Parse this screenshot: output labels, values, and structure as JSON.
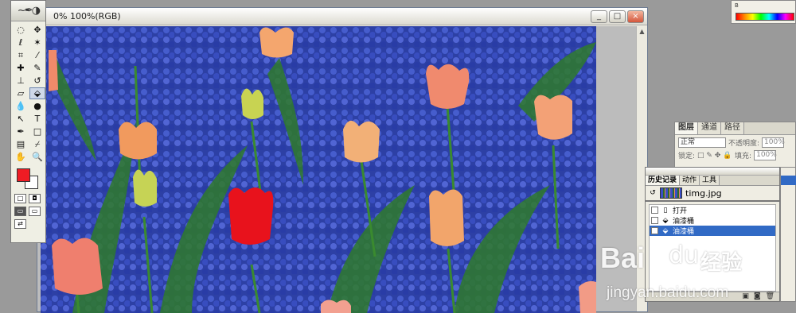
{
  "document": {
    "title": "0% 100%(RGB)",
    "buttons": [
      "_",
      "□",
      "×"
    ]
  },
  "toolbox": {
    "logo_icon": "feather-icon",
    "tools": [
      {
        "name": "marquee-icon",
        "glyph": "◌"
      },
      {
        "name": "move-icon",
        "glyph": "✥"
      },
      {
        "name": "lasso-icon",
        "glyph": "ℓ"
      },
      {
        "name": "magic-wand-icon",
        "glyph": "✶"
      },
      {
        "name": "crop-icon",
        "glyph": "⌗"
      },
      {
        "name": "slice-icon",
        "glyph": "⁄"
      },
      {
        "name": "healing-brush-icon",
        "glyph": "✚"
      },
      {
        "name": "brush-icon",
        "glyph": "✎"
      },
      {
        "name": "clone-stamp-icon",
        "glyph": "⊥"
      },
      {
        "name": "history-brush-icon",
        "glyph": "↺"
      },
      {
        "name": "eraser-icon",
        "glyph": "▱"
      },
      {
        "name": "paint-bucket-icon",
        "glyph": "⬙"
      },
      {
        "name": "blur-icon",
        "glyph": "💧"
      },
      {
        "name": "dodge-icon",
        "glyph": "●"
      },
      {
        "name": "path-select-icon",
        "glyph": "↖"
      },
      {
        "name": "type-icon",
        "glyph": "T"
      },
      {
        "name": "pen-icon",
        "glyph": "✒"
      },
      {
        "name": "rectangle-icon",
        "glyph": "□"
      },
      {
        "name": "notes-icon",
        "glyph": "▤"
      },
      {
        "name": "eyedropper-icon",
        "glyph": "⌿"
      },
      {
        "name": "hand-icon",
        "glyph": "✋"
      },
      {
        "name": "zoom-icon",
        "glyph": "🔍"
      }
    ],
    "active_tool": "paint-bucket-icon",
    "foreground_color": "#ee1c24",
    "background_color": "#ffffff"
  },
  "layers_panel": {
    "tabs": [
      "图层",
      "通道",
      "路径"
    ],
    "blend_mode": "正常",
    "opacity_label": "不透明度:",
    "opacity_value": "100%",
    "lock_label": "锁定:",
    "fill_label": "填充:",
    "fill_value": "100%"
  },
  "history_panel": {
    "tabs": [
      "历史记录",
      "动作",
      "工具"
    ],
    "snapshot_name": "timg.jpg",
    "items": [
      {
        "label": "打开",
        "icon": "document-icon",
        "glyph": "▯"
      },
      {
        "label": "油漆桶",
        "icon": "paint-bucket-icon",
        "glyph": "⬙"
      },
      {
        "label": "油漆桶",
        "icon": "paint-bucket-icon",
        "glyph": "⬙"
      }
    ],
    "active_index": 2,
    "footer_icons": [
      "new-document-icon",
      "snapshot-icon",
      "trash-icon"
    ]
  },
  "color_palette": {
    "label": "B"
  },
  "watermark": {
    "logo": "Bai",
    "paw": "du",
    "chinese": "经验",
    "url": "jingyan.baidu.com"
  }
}
